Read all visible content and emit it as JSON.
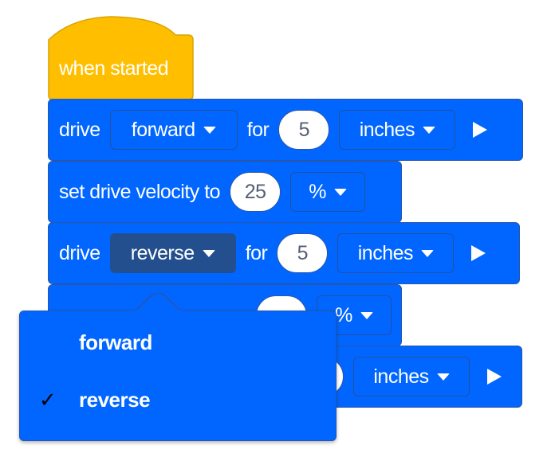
{
  "colors": {
    "motion_blue": "#0066ff",
    "event_yellow": "#ffbf00",
    "selected_field": "#234f8e"
  },
  "hat": {
    "label": "when started"
  },
  "blocks": [
    {
      "label": "drive",
      "direction": "forward",
      "for": "for",
      "distance": "5",
      "unit": "inches",
      "run_icon": "play-icon"
    },
    {
      "label": "set drive velocity to",
      "value": "25",
      "unit": "%"
    },
    {
      "label": "drive",
      "direction": "reverse",
      "for": "for",
      "distance": "5",
      "unit": "inches",
      "run_icon": "play-icon"
    },
    {
      "unit": "%"
    },
    {
      "unit": "inches",
      "run_icon": "play-icon"
    }
  ],
  "dropdown_menu": {
    "items": [
      {
        "label": "forward",
        "checked": false
      },
      {
        "label": "reverse",
        "checked": true
      }
    ],
    "check_glyph": "✓"
  }
}
